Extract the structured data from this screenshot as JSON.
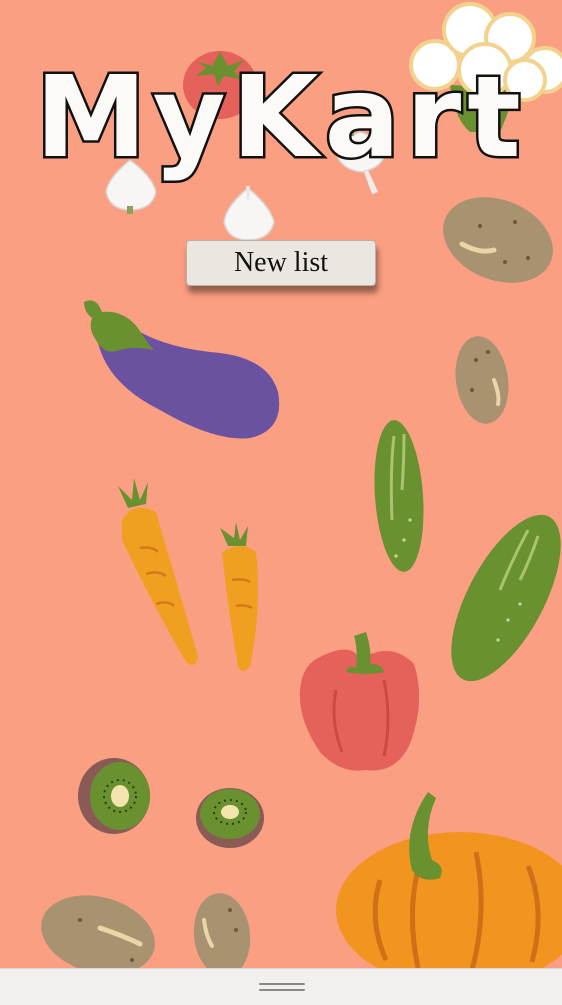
{
  "app": {
    "title": "MyKart",
    "new_list_label": "New list"
  },
  "colors": {
    "background": "#fb9f83",
    "button_bg": "#ece6e0",
    "eggplant": "#6b52a1",
    "carrot": "#f0a021",
    "cucumber": "#6a9130",
    "pepper": "#e4625a",
    "potato": "#a99270",
    "pumpkin": "#f29520"
  },
  "decor": {
    "icons": [
      "tomato-icon",
      "cauliflower-icon",
      "garlic-icon",
      "potato-icon",
      "eggplant-icon",
      "cucumber-icon",
      "carrot-icon",
      "bell-pepper-icon",
      "kiwi-icon",
      "pumpkin-icon"
    ]
  },
  "nav": {
    "handle_icon": "drag-handle-icon"
  }
}
